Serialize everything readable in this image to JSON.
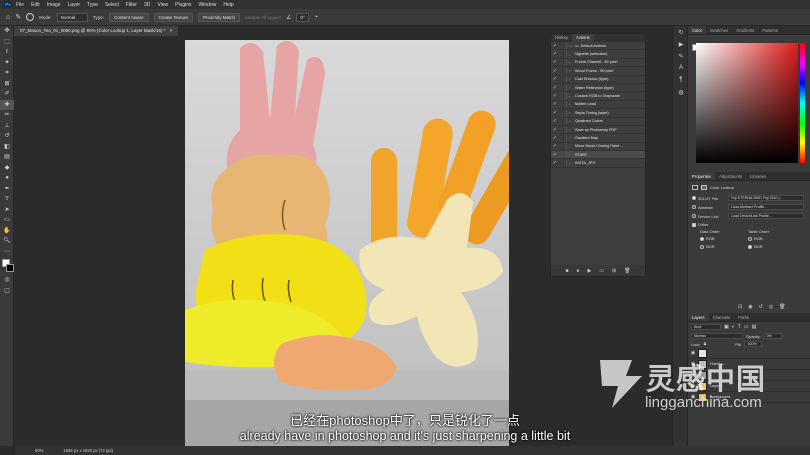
{
  "menubar": {
    "app_icon": "Ps",
    "items": [
      "File",
      "Edit",
      "Image",
      "Layer",
      "Type",
      "Select",
      "Filter",
      "3D",
      "View",
      "Plugins",
      "Window",
      "Help"
    ]
  },
  "options_bar": {
    "mode_label": "Mode:",
    "mode_value": "Normal",
    "type_label": "Type:",
    "type_buttons": [
      "Content Aware",
      "Create Texture",
      "Proximity Match"
    ],
    "sample_all": "Sample All Layers",
    "angle": "0°"
  },
  "document_tab": {
    "title": "07_Mason_Tea_01_0050.png @ 50% (Color Lookup 1, Layer Mask/16) *"
  },
  "actions_panel": {
    "tabs": [
      "History",
      "Actions"
    ],
    "active_tab": "Actions",
    "set_name": "Default Actions",
    "items": [
      "Vignette (selection)",
      "Frame Channel - 50 pixel",
      "Wood Frame - 50 pixel",
      "Cast Shadow (type)",
      "Water Reflection (type)",
      "Custom RGB to Grayscale",
      "Molten Lead",
      "Sepia Toning (layer)",
      "Quadrant Colors",
      "Save as Photoshop PDF",
      "Gradient Map",
      "Mixer Brush Cloning Paint ...",
      "START",
      "INSTA_JPG"
    ],
    "selected_index": 12
  },
  "color_panel": {
    "tabs": [
      "Color",
      "Swatches",
      "Gradients",
      "Patterns"
    ],
    "foreground": "#ffffff",
    "hue_color": "#e21b1b"
  },
  "properties_panel": {
    "tabs": [
      "Properties",
      "Adjustments",
      "Libraries"
    ],
    "adjustment": "Color Lookup",
    "lut_file_label": "3DLUT File",
    "lut_file_value": "Fuji ETERNA 250D Fuji 3510 (...",
    "abstract_label": "Abstract",
    "abstract_value": "Load Abstract Profile...",
    "device_link_label": "Device Link",
    "device_link_value": "Load DeviceLink Profile...",
    "dither_label": "Dither",
    "data_order_label": "Data Order",
    "table_order_label": "Table Order",
    "rgb": "RGB",
    "bgr": "BGR"
  },
  "layers_panel": {
    "tabs": [
      "Layers",
      "Channels",
      "Paths"
    ],
    "kind_label": "Kind",
    "blend_mode": "Normal",
    "opacity_label": "Opacity:",
    "opacity_value": "0%",
    "lock_label": "Lock:",
    "fill_label": "Fill:",
    "fill_value": "100%",
    "layers": [
      {
        "name": "",
        "thumb": "#e6e6e6"
      },
      {
        "name": "Hue/Sa...",
        "thumb": "#bdbdbd"
      },
      {
        "name": "",
        "thumb": "#9a9a9a"
      },
      {
        "name": "Layer 1",
        "thumb": "#e9c46a"
      },
      {
        "name": "Background",
        "thumb": "#e4c06a"
      }
    ]
  },
  "status_bar": {
    "zoom": "50%",
    "dimensions": "1536 px x 1920 px (72 ppi)"
  },
  "subtitles": {
    "chinese": "已经在photoshop中了，只是锐化了一点",
    "english": "already have in photoshop and it's just sharpening a little bit"
  },
  "watermark": {
    "chinese": "灵感中国",
    "english": "lingganchina.com"
  }
}
